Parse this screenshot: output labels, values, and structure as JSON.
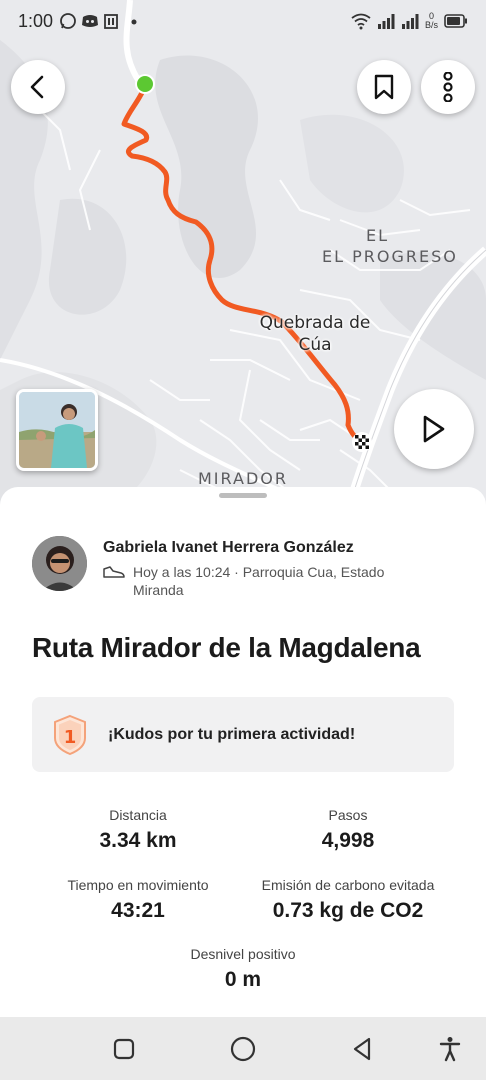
{
  "status_bar": {
    "time": "1:00",
    "net_speed_value": "0",
    "net_speed_unit": "B/s"
  },
  "map": {
    "labels": {
      "el_progreso": "EL PROGRESO",
      "quebrada": "Quebrada de Cúa",
      "mirador": "MIRADOR"
    },
    "route_color": "#f15a22",
    "start_color": "#5cc832"
  },
  "icons": {
    "back": "chevron-left-icon",
    "bookmark": "bookmark-icon",
    "more": "more-vertical-icon",
    "play": "play-icon"
  },
  "activity": {
    "athlete_name": "Gabriela Ivanet Herrera González",
    "meta_line1": "Hoy a las 10:24 · Parroquia Cua, Estado",
    "meta_line2": "Miranda",
    "title": "Ruta Mirador de la Magdalena",
    "kudos_badge_number": "1",
    "kudos_text": "¡Kudos por tu primera actividad!",
    "accent_color": "#f15a22"
  },
  "stats": {
    "distance_label": "Distancia",
    "distance_value": "3.34 km",
    "steps_label": "Pasos",
    "steps_value": "4,998",
    "moving_time_label": "Tiempo en movimiento",
    "moving_time_value": "43:21",
    "carbon_label": "Emisión de carbono evitada",
    "carbon_value": "0.73 kg de CO2",
    "elevation_label": "Desnivel positivo",
    "elevation_value": "0 m"
  }
}
